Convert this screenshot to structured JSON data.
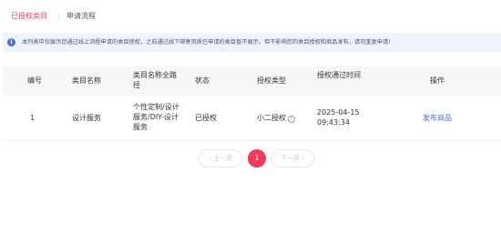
{
  "tabs": {
    "active": "已授权类目",
    "separator": "›",
    "other": "申请流程"
  },
  "notice": {
    "icon": "info-icon",
    "text": "本列表中仅展示您通过线上流程申请的类目授权，之前通过线下邮寄资质已申请的类目暂不展示，但不影响您的类目授权和商品发布，请勿重复申请!"
  },
  "table": {
    "headers": [
      "编号",
      "类目名称",
      "类目名称全路径",
      "状态",
      "授权类型",
      "授权通过时间",
      "操作"
    ],
    "rows": [
      {
        "id": "1",
        "name": "设计服务",
        "path": "个性定制/设计服务/DIY-设计服务",
        "status": "已授权",
        "auth_type": "小二授权",
        "auth_type_help": "?",
        "time": "2025-04-15 09:43:34",
        "action": "发布商品"
      }
    ]
  },
  "pagination": {
    "prev": "‹ 上一页",
    "current": "1",
    "next": "下一页 ›"
  },
  "colors": {
    "accent": "#ee3d6a",
    "link": "#4a6fd6",
    "notice_bg": "#eef3fb"
  }
}
